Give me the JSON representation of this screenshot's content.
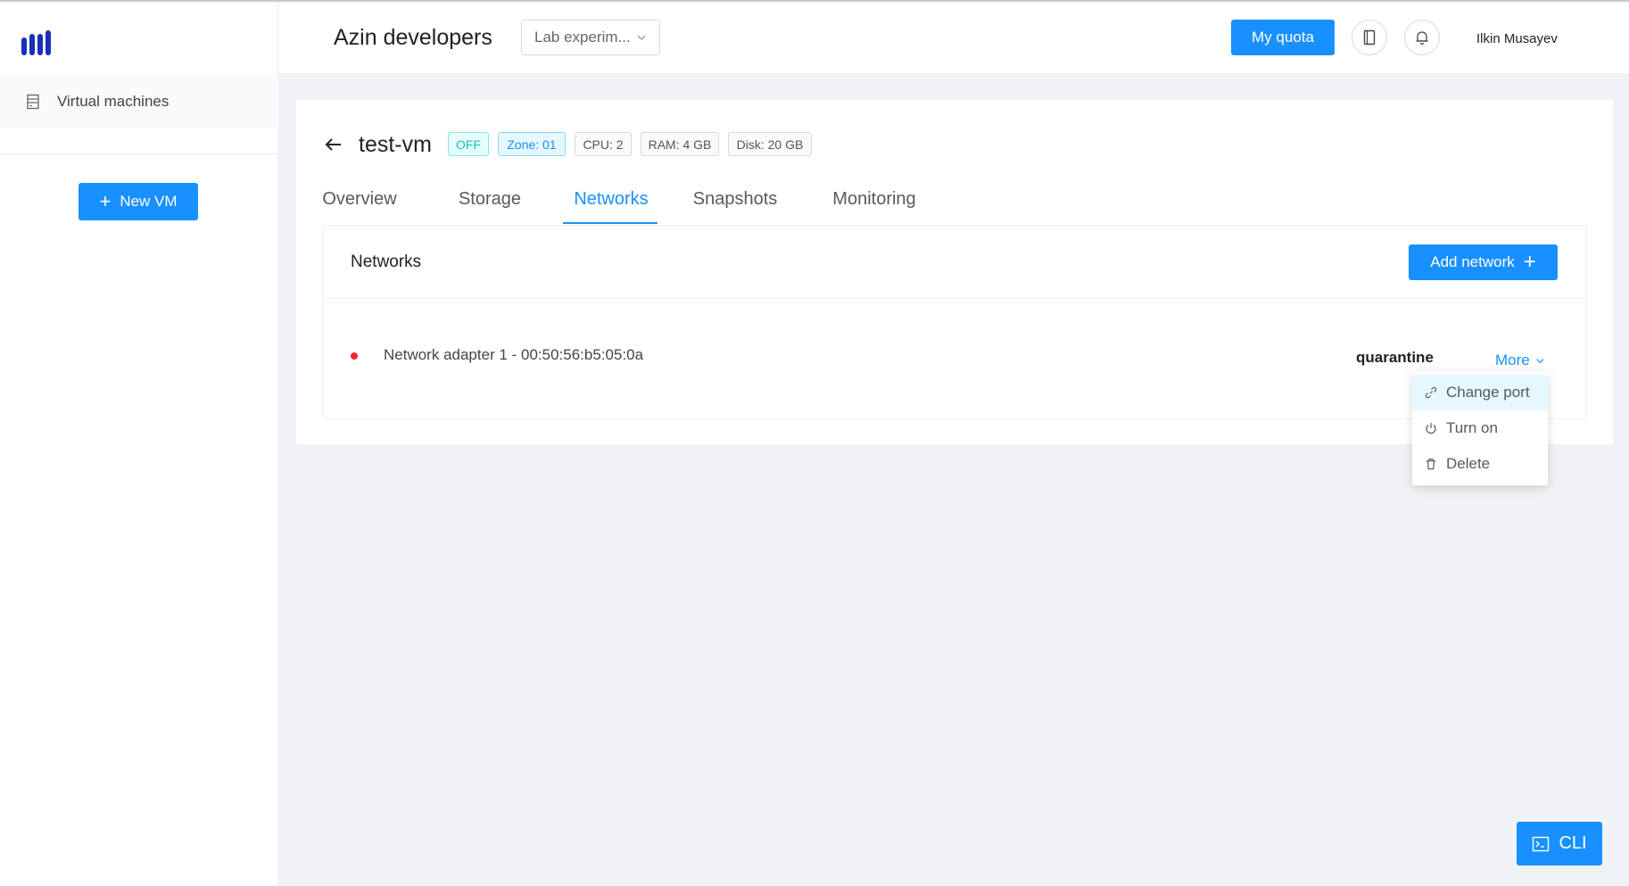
{
  "sidebar": {
    "logo_icon": "brand-bars-icon",
    "items": [
      {
        "label": "Virtual machines",
        "icon": "server-icon"
      }
    ],
    "new_vm_label": "New VM"
  },
  "header": {
    "org_title": "Azin developers",
    "project_select": "Lab experim...",
    "quota_label": "My quota",
    "user_name": "Ilkin Musayev",
    "icons": [
      "book-icon",
      "bell-icon"
    ]
  },
  "vm": {
    "name": "test-vm",
    "tags": {
      "state": "OFF",
      "zone": "Zone: 01",
      "cpu": "CPU: 2",
      "ram": "RAM: 4 GB",
      "disk": "Disk: 20 GB"
    }
  },
  "tabs": [
    {
      "label": "Overview"
    },
    {
      "label": "Storage"
    },
    {
      "label": "Networks",
      "active": true
    },
    {
      "label": "Snapshots"
    },
    {
      "label": "Monitoring"
    }
  ],
  "networks": {
    "title": "Networks",
    "add_label": "Add network",
    "rows": [
      {
        "label": "Network adapter 1 - 00:50:56:b5:05:0a",
        "status": "quarantine",
        "more_label": "More"
      }
    ]
  },
  "dropdown": {
    "items": [
      {
        "label": "Change port",
        "icon": "link-icon"
      },
      {
        "label": "Turn on",
        "icon": "power-icon"
      },
      {
        "label": "Delete",
        "icon": "trash-icon"
      }
    ]
  },
  "cli_label": "CLI",
  "colors": {
    "primary": "#1890ff",
    "danger": "#f5222d",
    "off_tag": "#13c2c2",
    "brand": "#1a2fb8"
  }
}
